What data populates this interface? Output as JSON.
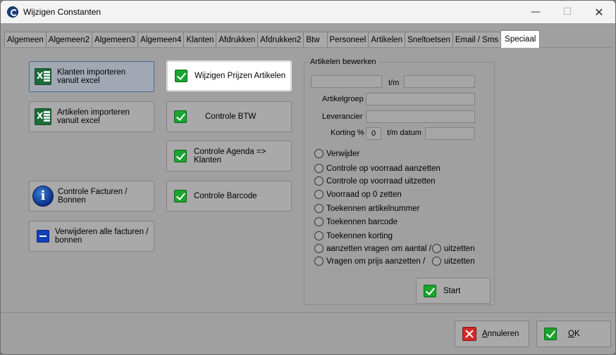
{
  "window": {
    "title": "Wijzigen Constanten",
    "controls": {
      "minimize": "—",
      "maximize": "☐",
      "close": "✕"
    }
  },
  "tabs": [
    {
      "label": "Algemeen"
    },
    {
      "label": "Algemeen2"
    },
    {
      "label": "Algemeen3"
    },
    {
      "label": "Algemeen4"
    },
    {
      "label": "Klanten"
    },
    {
      "label": "Afdrukken"
    },
    {
      "label": "Afdrukken2"
    },
    {
      "label": "Btw"
    },
    {
      "label": "Personeel"
    },
    {
      "label": "Artikelen"
    },
    {
      "label": "Sneltoetsen"
    },
    {
      "label": "Email / Sms"
    },
    {
      "label": "Speciaal",
      "active": true
    }
  ],
  "left_buttons": {
    "import_klanten": "Klanten importeren vanuit excel",
    "import_artikelen": "Artikelen importeren vanuit excel",
    "controle_facturen": "Controle Facturen / Bonnen",
    "verwijderen_facturen": "Verwijderen alle facturen / bonnen"
  },
  "middle_buttons": {
    "wijzigen_prijzen": "Wijzigen Prijzen Artikelen",
    "controle_btw": "Controle BTW",
    "controle_agenda": "Controle Agenda => Klanten",
    "controle_barcode": "Controle Barcode"
  },
  "artikelen_bewerken": {
    "title": "Artikelen bewerken",
    "tm_label": "t/m",
    "artikelgroep_label": "Artikelgroep",
    "leverancier_label": "Leverancier",
    "korting_label": "Korting %",
    "korting_value": "0",
    "tm_datum_label": "t/m datum",
    "range_from": "",
    "range_to": "",
    "artikelgroep_value": "",
    "leverancier_value": "",
    "datum_value": "",
    "options": [
      "Verwijder",
      "Controle op voorraad aanzetten",
      "Controle op voorraad uitzetten",
      "Voorraad op 0 zetten",
      "Toekennen artikelnummer",
      "Toekennen barcode",
      "Toekennen korting",
      "aanzetten vragen om aantal /",
      "Vragen om prijs aanzetten /"
    ],
    "uitzetten_1": "uitzetten",
    "uitzetten_2": "uitzetten",
    "start_label": "Start"
  },
  "footer": {
    "annuleren_first": "A",
    "annuleren_rest": "nnuleren",
    "ok_first": "O",
    "ok_rest": "K"
  }
}
